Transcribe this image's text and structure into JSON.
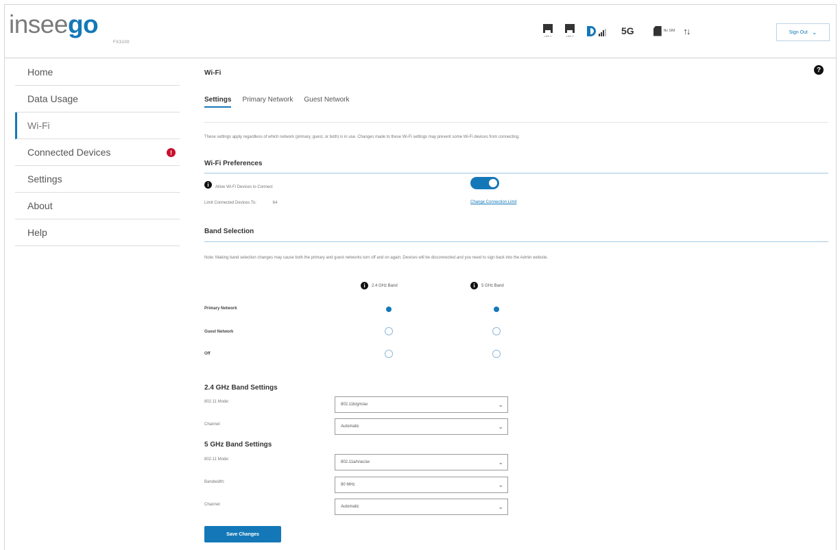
{
  "brand": {
    "logo_prefix": "insee",
    "logo_suffix": "go",
    "model": "FX3100"
  },
  "status": {
    "port1_label": "LAN 1",
    "port2_label": "LAN 2",
    "network": "5G",
    "sim_text": "No SIM",
    "data_arrows": "↑↓",
    "signout_label": "Sign Out",
    "accent_color": "#1478b8",
    "alert_color": "#c8102e"
  },
  "sidebar": {
    "items": [
      {
        "label": "Home"
      },
      {
        "label": "Data Usage"
      },
      {
        "label": "Wi-Fi",
        "active": true
      },
      {
        "label": "Connected Devices",
        "badge": "!"
      },
      {
        "label": "Settings"
      },
      {
        "label": "About"
      },
      {
        "label": "Help"
      }
    ]
  },
  "main": {
    "title": "Wi-Fi",
    "help_icon": "?",
    "tabs": [
      {
        "label": "Settings",
        "active": true
      },
      {
        "label": "Primary Network"
      },
      {
        "label": "Guest Network"
      }
    ],
    "intro": "These settings apply regardless of which network (primary, guest, or both) is in use. Changes made to these Wi-Fi settings may prevent some Wi-Fi devices from connecting.",
    "preferences": {
      "title": "Wi-Fi Preferences",
      "allow_label": "Allow Wi-Fi Devices to Connect",
      "allow_on": true,
      "limit_label": "Limit Connected Devices To:",
      "limit_value": "64",
      "link_text": "Change Connection Limit"
    },
    "band_selection": {
      "title": "Band Selection",
      "note": "Note: Making band selection changes may cause both the primary and guest networks turn off and on again. Devices will be disconnected and you need to sign back into the Admin website.",
      "col_24": "2.4 GHz Band",
      "col_5": "5 GHz Band",
      "rows": [
        {
          "label": "Primary Network",
          "band24": true,
          "band5": true
        },
        {
          "label": "Guest Network",
          "band24": false,
          "band5": false
        },
        {
          "label": "Off",
          "band24": false,
          "band5": false
        }
      ]
    },
    "band24_settings": {
      "title": "2.4 GHz Band Settings",
      "mode_label": "802.11 Mode:",
      "mode_value": "802.11b/g/n/ax",
      "channel_label": "Channel:",
      "channel_value": "Automatic"
    },
    "band5_settings": {
      "title": "5 GHz Band Settings",
      "mode_label": "802.11 Mode:",
      "mode_value": "802.11a/n/ac/ax",
      "bandwidth_label": "Bandwidth:",
      "bandwidth_value": "80 MHz",
      "channel_label": "Channel:",
      "channel_value": "Automatic"
    },
    "save_label": "Save Changes"
  }
}
